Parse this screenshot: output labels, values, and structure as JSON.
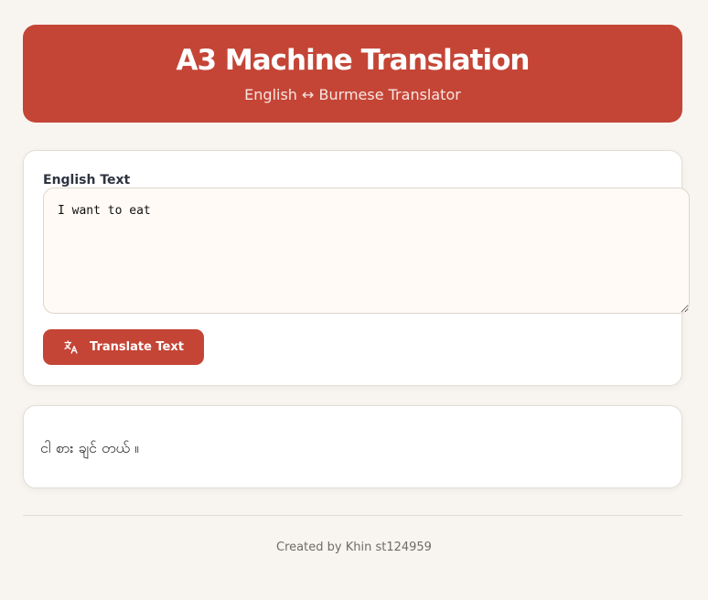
{
  "header": {
    "title": "A3 Machine Translation",
    "subtitle": "English ↔ Burmese Translator"
  },
  "input": {
    "label": "English Text",
    "value": "I want to eat"
  },
  "actions": {
    "translate_label": "Translate Text",
    "translate_icon": "translate-icon"
  },
  "output": {
    "text": "ငါ စား ချင် တယ် ။"
  },
  "footer": {
    "text": "Created by Khin st124959"
  },
  "colors": {
    "accent": "#c44536",
    "background": "#f8f5f0",
    "card": "#ffffff",
    "input_background": "#fffaf6"
  }
}
